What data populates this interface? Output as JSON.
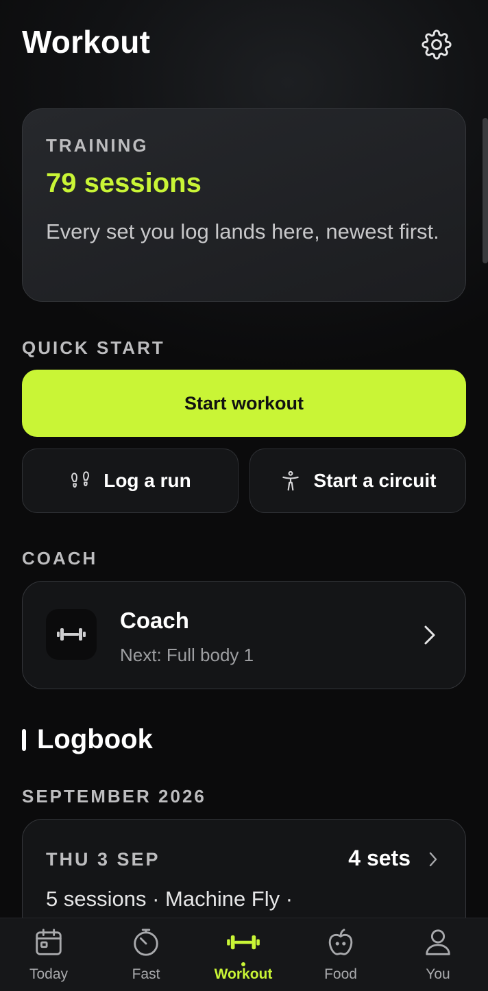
{
  "header": {
    "title": "Workout",
    "settings_icon": "gear-icon"
  },
  "training": {
    "label": "TRAINING",
    "count": "79 sessions",
    "description": "Every set you log lands here, newest first."
  },
  "quick_start": {
    "label": "QUICK START",
    "primary_button": "Start workout",
    "run_button": {
      "label": "Log a run",
      "icon": "footprints-icon"
    },
    "circuit_button": {
      "label": "Start a circuit",
      "icon": "person-icon"
    }
  },
  "coach": {
    "section_label": "COACH",
    "title": "Coach",
    "subtitle": "Next: Full body 1",
    "icon": "dumbbell-icon"
  },
  "logbook": {
    "title": "Logbook",
    "month": "SEPTEMBER 2026",
    "entries": [
      {
        "date": "THU 3 SEP",
        "sets": "4 sets",
        "summary": "5 sessions · Machine Fly ·"
      }
    ]
  },
  "tabs": [
    {
      "label": "Today",
      "icon": "calendar-icon",
      "active": false
    },
    {
      "label": "Fast",
      "icon": "timer-icon",
      "active": false
    },
    {
      "label": "Workout",
      "icon": "dumbbell-icon",
      "active": true
    },
    {
      "label": "Food",
      "icon": "apple-icon",
      "active": false
    },
    {
      "label": "You",
      "icon": "user-icon",
      "active": false
    }
  ],
  "colors": {
    "accent": "#c9f536",
    "background": "#0b0b0c",
    "card": "#141517",
    "muted_text": "#bdbdbf"
  }
}
